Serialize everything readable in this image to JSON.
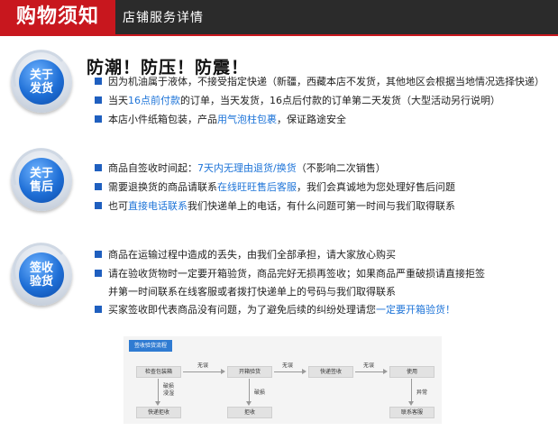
{
  "header": {
    "title": "购物须知",
    "subtitle": "店铺服务详情"
  },
  "heading": "防潮！防压！防震！",
  "sections": [
    {
      "badge": [
        "关于",
        "发货"
      ]
    },
    {
      "badge": [
        "关于",
        "售后"
      ]
    },
    {
      "badge": [
        "签收",
        "验货"
      ]
    }
  ],
  "shipping": {
    "line1": "因为机油属于液体，不接受指定快递（新疆，西藏本店不发货，其他地区会根据当地情况选择快递）",
    "line2_a": "当天",
    "line2_hl": "16点前付款",
    "line2_b": "的订单，当天发货，16点后付款的订单第二天发货（大型活动另行说明）",
    "line3_a": "本店小件纸箱包装，产品",
    "line3_hl": "用气泡柱包裹",
    "line3_b": "，保证路途安全"
  },
  "after_sales": {
    "line1_a": "商品自签收时间起：",
    "line1_hl": "7天内无理由退货/换货",
    "line1_b": "（不影响二次销售）",
    "line2_a": "需要退换货的商品请联系",
    "line2_hl": "在线旺旺售后客服",
    "line2_b": "，我们会真诚地为您处理好售后问题",
    "line3_a": "也可",
    "line3_hl": "直接电话联系",
    "line3_b": "我们快递单上的电话，有什么问题可第一时间与我们取得联系"
  },
  "inspection": {
    "line1": "商品在运输过程中造成的丢失，由我们全部承担，请大家放心购买",
    "line2": "请在验收货物时一定要开箱验货，商品完好无损再签收；如果商品严重破损请直接拒签",
    "line3": "并第一时间联系在线客服或者拨打快递单上的号码与我们取得联系",
    "line4_a": "买家签收即代表商品没有问题，为了避免后续的纠纷处理请您",
    "line4_hl": "一定要开箱验货！"
  },
  "flow": {
    "tag": "签收验货流程",
    "boxes": {
      "check": "检查包装箱",
      "open": "开箱验货",
      "sign": "快递签收",
      "use": "使用",
      "courier_reject": "快递拒收",
      "reject": "拒收",
      "contact": "联系客服"
    },
    "labels": {
      "ok1": "无误",
      "ok2": "无误",
      "ok3": "无误",
      "damaged_wet": "破损\n浸湿",
      "damaged": "破损",
      "abnormal": "异常"
    }
  },
  "colors": {
    "accent_red": "#c8171e",
    "header_dark": "#2b2b2b",
    "highlight_blue": "#1e74d8",
    "bullet_blue": "#1f5fbf"
  }
}
